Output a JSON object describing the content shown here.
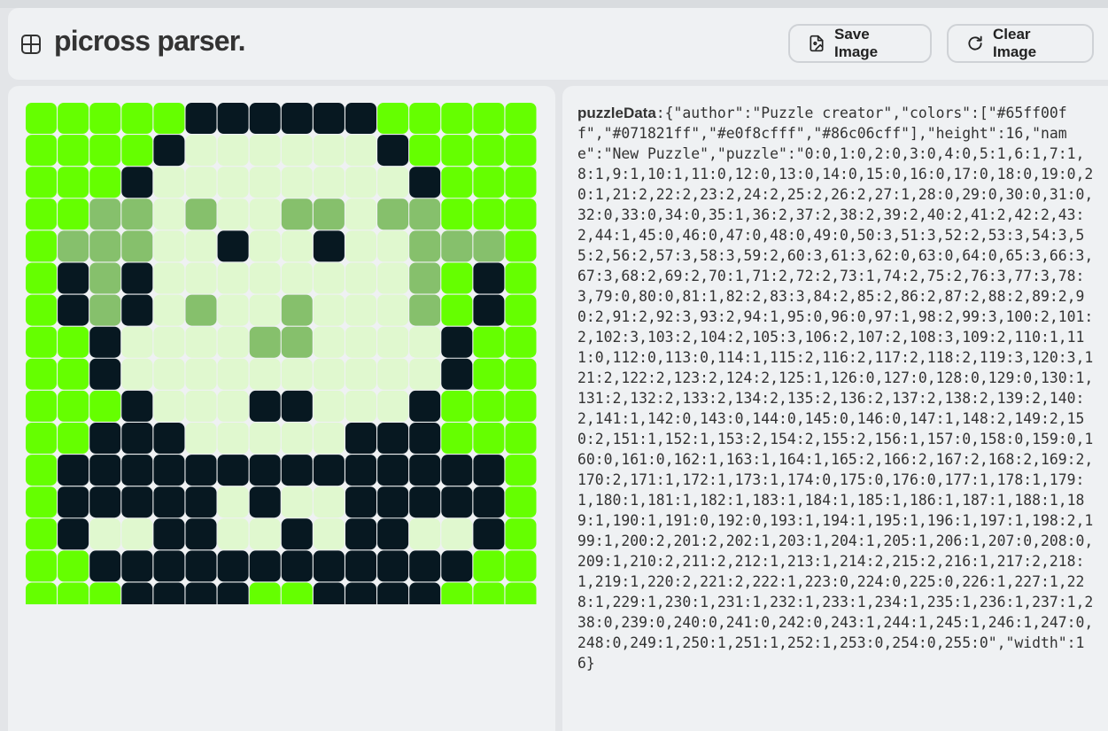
{
  "app": {
    "title": "picross parser."
  },
  "toolbar": {
    "save_label": "Save Image",
    "clear_label": "Clear Image"
  },
  "icons": {
    "logo": "grid-icon",
    "save": "file-image-icon",
    "clear": "refresh-icon"
  },
  "puzzle": {
    "width": 16,
    "height": 16,
    "empty_color": "#e0f8cf",
    "color_values": {
      "0": "#65ff00",
      "1": "#071821",
      "2": "#e0f8cf",
      "3": "#86c06c"
    },
    "rows": [
      "0000011111100000",
      "0000122222210000",
      "0001222222221000",
      "0033232233233000",
      "0333221221223330",
      "0131222222223010",
      "0131232232223010",
      "0012222332222100",
      "0012222222222100",
      "0001222112221000",
      "0011122222111000",
      "0111111111111110",
      "0111112122111110",
      "0122112212112210",
      "0011111111111100",
      "0001111001111000"
    ]
  },
  "output": {
    "label": "puzzleData",
    "separator": ":",
    "text": "{\"author\":\"Puzzle creator\",\"colors\":[\"#65ff00ff\",\"#071821ff\",\"#e0f8cfff\",\"#86c06cff\"],\"height\":16,\"name\":\"New Puzzle\",\"puzzle\":\"0:0,1:0,2:0,3:0,4:0,5:1,6:1,7:1,8:1,9:1,10:1,11:0,12:0,13:0,14:0,15:0,16:0,17:0,18:0,19:0,20:1,21:2,22:2,23:2,24:2,25:2,26:2,27:1,28:0,29:0,30:0,31:0,32:0,33:0,34:0,35:1,36:2,37:2,38:2,39:2,40:2,41:2,42:2,43:2,44:1,45:0,46:0,47:0,48:0,49:0,50:3,51:3,52:2,53:3,54:3,55:2,56:2,57:3,58:3,59:2,60:3,61:3,62:0,63:0,64:0,65:3,66:3,67:3,68:2,69:2,70:1,71:2,72:2,73:1,74:2,75:2,76:3,77:3,78:3,79:0,80:0,81:1,82:2,83:3,84:2,85:2,86:2,87:2,88:2,89:2,90:2,91:2,92:3,93:2,94:1,95:0,96:0,97:1,98:2,99:3,100:2,101:2,102:3,103:2,104:2,105:3,106:2,107:2,108:3,109:2,110:1,111:0,112:0,113:0,114:1,115:2,116:2,117:2,118:2,119:3,120:3,121:2,122:2,123:2,124:2,125:1,126:0,127:0,128:0,129:0,130:1,131:2,132:2,133:2,134:2,135:2,136:2,137:2,138:2,139:2,140:2,141:1,142:0,143:0,144:0,145:0,146:0,147:1,148:2,149:2,150:2,151:1,152:1,153:2,154:2,155:2,156:1,157:0,158:0,159:0,160:0,161:0,162:1,163:1,164:1,165:2,166:2,167:2,168:2,169:2,170:2,171:1,172:1,173:1,174:0,175:0,176:0,177:1,178:1,179:1,180:1,181:1,182:1,183:1,184:1,185:1,186:1,187:1,188:1,189:1,190:1,191:0,192:0,193:1,194:1,195:1,196:1,197:1,198:2,199:1,200:2,201:2,202:1,203:1,204:1,205:1,206:1,207:0,208:0,209:1,210:2,211:2,212:1,213:1,214:2,215:2,216:1,217:2,218:1,219:1,220:2,221:2,222:1,223:0,224:0,225:0,226:1,227:1,228:1,229:1,230:1,231:1,232:1,233:1,234:1,235:1,236:1,237:1,238:0,239:0,240:0,241:0,242:0,243:1,244:1,245:1,246:1,247:0,248:0,249:1,250:1,251:1,252:1,253:0,254:0,255:0\",\"width\":16}"
  }
}
